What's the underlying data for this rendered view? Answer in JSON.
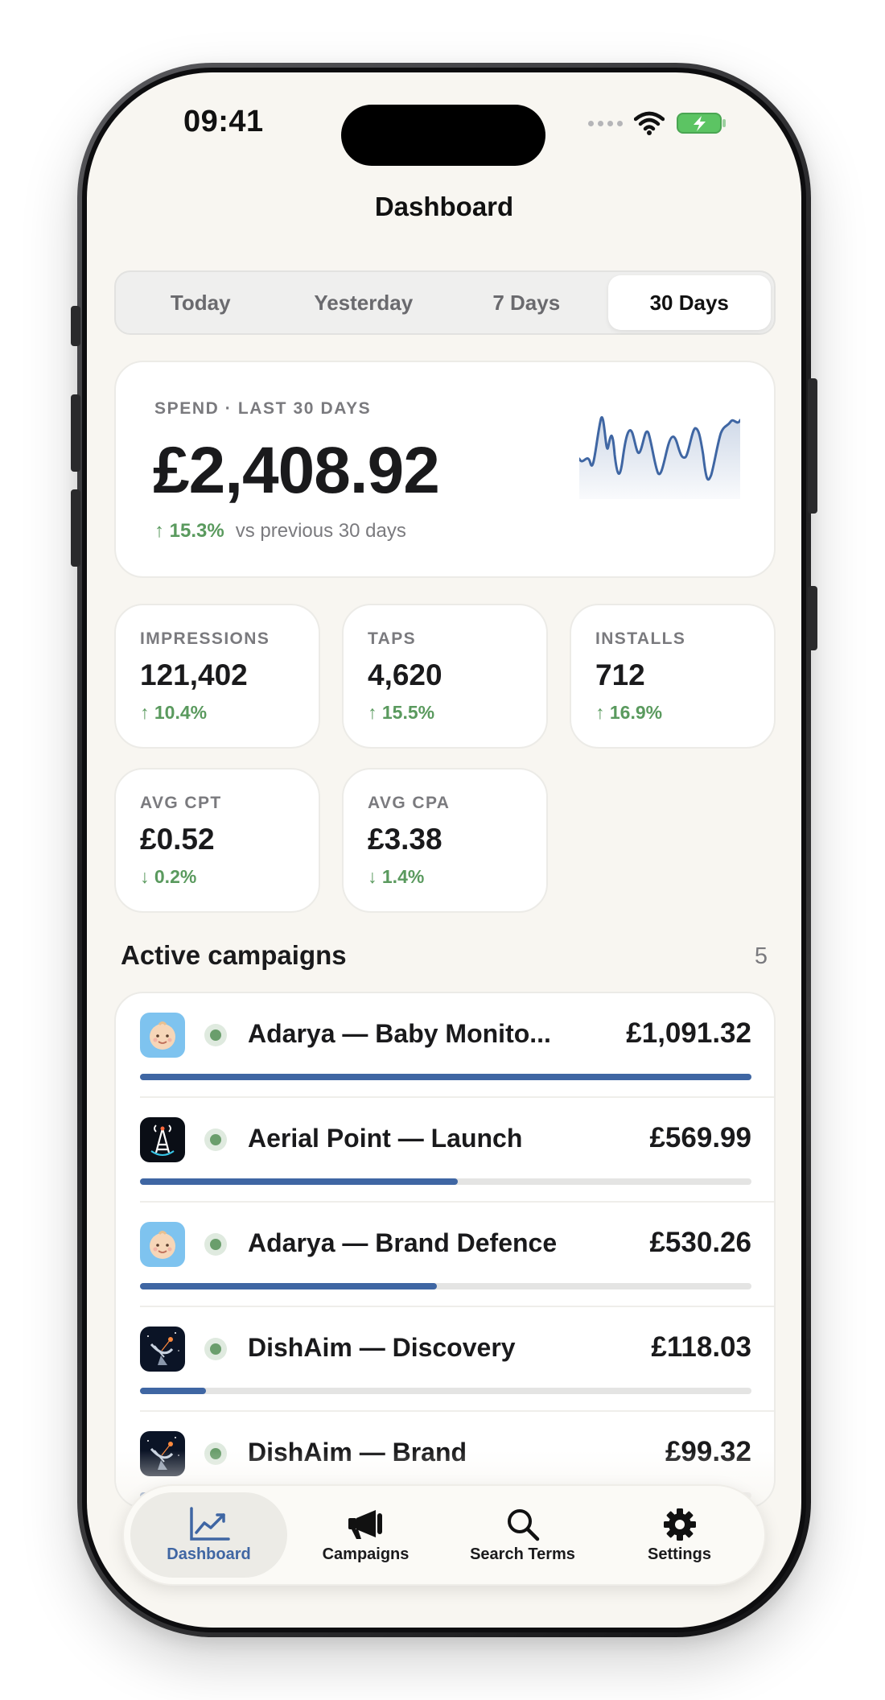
{
  "status_bar": {
    "time": "09:41"
  },
  "screen": {
    "title": "Dashboard"
  },
  "segments": [
    {
      "label": "Today",
      "active": false
    },
    {
      "label": "Yesterday",
      "active": false
    },
    {
      "label": "7 Days",
      "active": false
    },
    {
      "label": "30 Days",
      "active": true
    }
  ],
  "spend": {
    "label": "SPEND · LAST 30 DAYS",
    "value": "£2,408.92",
    "delta": "15.3%",
    "comparison": "vs previous 30 days",
    "sparkline_color": "#3f66a3"
  },
  "metrics": [
    {
      "label": "IMPRESSIONS",
      "value": "121,402",
      "delta": "10.4%",
      "direction": "up"
    },
    {
      "label": "TAPS",
      "value": "4,620",
      "delta": "15.5%",
      "direction": "up"
    },
    {
      "label": "INSTALLS",
      "value": "712",
      "delta": "16.9%",
      "direction": "up"
    },
    {
      "label": "AVG CPT",
      "value": "£0.52",
      "delta": "0.2%",
      "direction": "down"
    },
    {
      "label": "AVG CPA",
      "value": "£3.38",
      "delta": "1.4%",
      "direction": "down"
    }
  ],
  "campaigns_section": {
    "title": "Active campaigns",
    "count": "5"
  },
  "campaigns": [
    {
      "name": "Adarya — Baby Monito...",
      "amount": "£1,091.32",
      "share": 1.0,
      "icon": "baby-app-icon"
    },
    {
      "name": "Aerial Point — Launch",
      "amount": "£569.99",
      "share": 0.52,
      "icon": "antenna-app-icon"
    },
    {
      "name": "Adarya — Brand Defence",
      "amount": "£530.26",
      "share": 0.486,
      "icon": "baby-app-icon"
    },
    {
      "name": "DishAim — Discovery",
      "amount": "£118.03",
      "share": 0.108,
      "icon": "satellite-dish-app-icon"
    },
    {
      "name": "DishAim — Brand",
      "amount": "£99.32",
      "share": 0.091,
      "icon": "satellite-dish-app-icon"
    }
  ],
  "tabbar": [
    {
      "label": "Dashboard",
      "icon": "chart-icon",
      "active": true
    },
    {
      "label": "Campaigns",
      "icon": "megaphone-icon",
      "active": false
    },
    {
      "label": "Search Terms",
      "icon": "search-icon",
      "active": false
    },
    {
      "label": "Settings",
      "icon": "gear-icon",
      "active": false
    }
  ],
  "colors": {
    "accent": "#3f66a3",
    "positive": "#5a9a5e",
    "background": "#f8f6f1"
  }
}
